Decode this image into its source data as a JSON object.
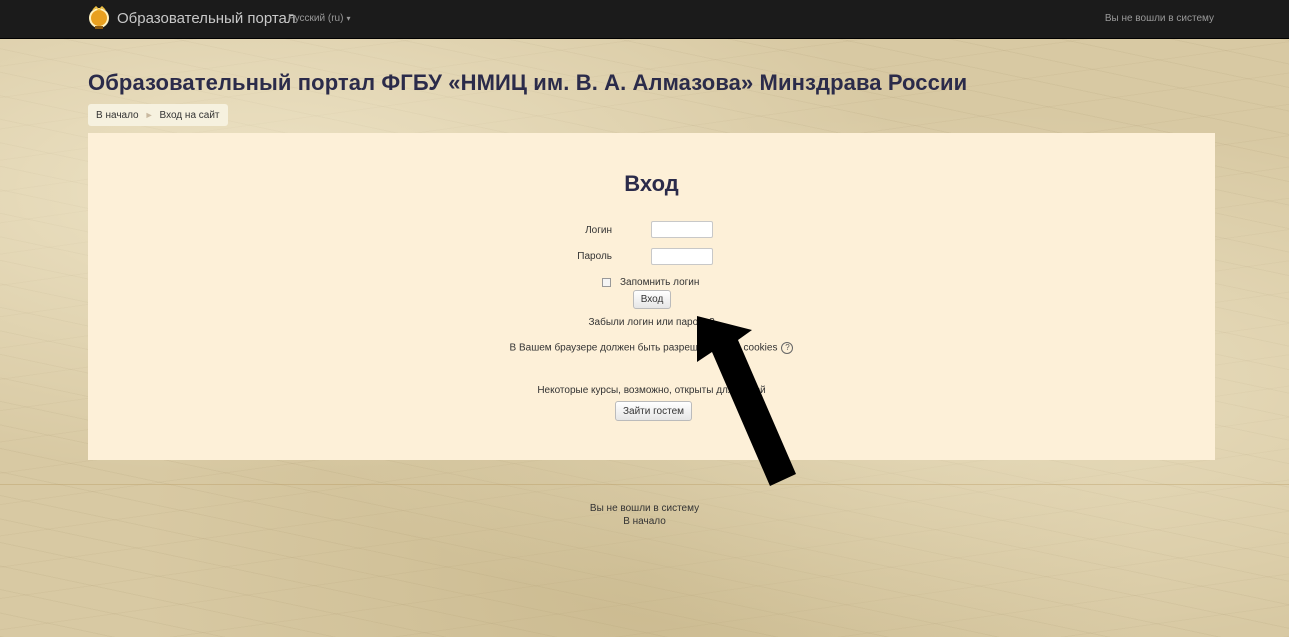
{
  "navbar": {
    "brand": "Образовательный портал",
    "language": "Русский (ru)",
    "login_status": "Вы не вошли в систему"
  },
  "header": {
    "site_title": "Образовательный портал ФГБУ «НМИЦ им. В. А. Алмазова» Минздрава России"
  },
  "breadcrumb": {
    "items": [
      {
        "label": "В начало"
      },
      {
        "label": "Вход на сайт"
      }
    ]
  },
  "login": {
    "title": "Вход",
    "username_label": "Логин",
    "username_value": "",
    "password_label": "Пароль",
    "password_value": "",
    "remember_label": "Запомнить логин",
    "remember_checked": false,
    "submit_label": "Вход",
    "forgot_link": "Забыли логин или пароль?",
    "cookies_notice": "В Вашем браузере должен быть разрешен прием cookies",
    "guest_notice": "Некоторые курсы, возможно, открыты для гостей",
    "guest_button": "Зайти гостем"
  },
  "footer": {
    "login_status": "Вы не вошли в систему",
    "home_link": "В начало"
  },
  "colors": {
    "navbar_bg": "#1b1b1b",
    "panel_bg": "#fdf0d8",
    "title_color": "#2b2b4a",
    "annotation_arrow": "#000000"
  },
  "icons": {
    "brand": "hot-air-balloon-icon",
    "help": "question-circle-icon",
    "caret": "chevron-down-icon",
    "annotation": "arrow-annotation"
  }
}
